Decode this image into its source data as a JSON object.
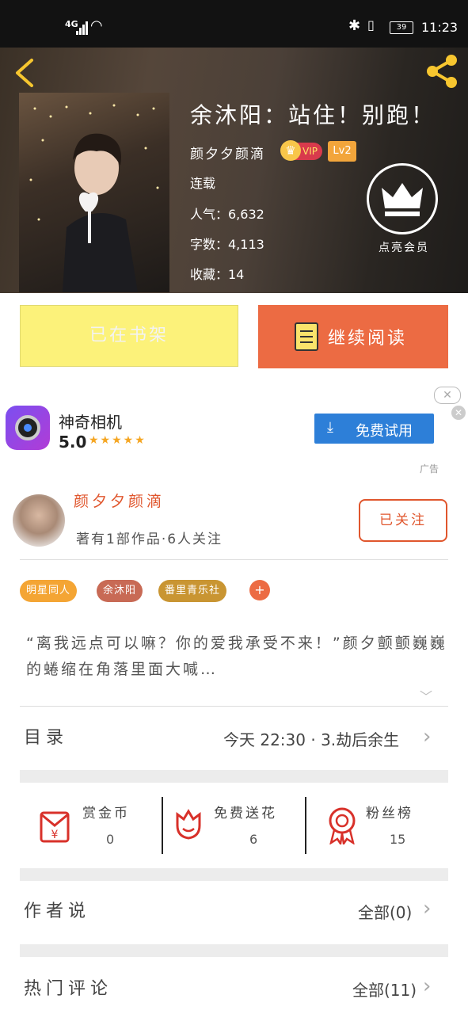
{
  "status_bar": {
    "signal_type": "4G",
    "battery": "39",
    "time": "11:23"
  },
  "book": {
    "title": "余沐阳：站住！别跑！",
    "author": "颜夕夕颜滴",
    "vip_label": "VIP",
    "level": "Lv2",
    "status": "连载",
    "popularity": "人气：6,632",
    "word_count": "字数：4,113",
    "favorites": "收藏：14",
    "recommend_label": "点亮会员"
  },
  "actions": {
    "shelf_label": "已在书架",
    "read_label": "继续阅读"
  },
  "ad": {
    "app_name": "神奇相机",
    "rating": "5.0",
    "stars": "★★★★★",
    "cta": "免费试用",
    "label": "广告"
  },
  "author_section": {
    "name": "颜夕夕颜滴",
    "meta": "著有1部作品·6人关注",
    "follow_label": "已关注"
  },
  "tags": [
    "明星同人",
    "余沐阳",
    "番里青乐社"
  ],
  "tag_add": "+",
  "synopsis": "“离我远点可以嘛？你的爱我承受不来！”颜夕颤颤巍巍的蜷缩在角落里面大喊…",
  "catalog": {
    "title": "目录",
    "latest": "今天 22:30 · 3.劫后余生"
  },
  "stats": [
    {
      "label": "赏金币",
      "value": "0",
      "icon": "red-envelope-icon"
    },
    {
      "label": "免费送花",
      "value": "6",
      "icon": "flower-icon"
    },
    {
      "label": "粉丝榜",
      "value": "15",
      "icon": "medal-icon"
    }
  ],
  "author_notes": {
    "title": "作者说",
    "value": "全部(0)"
  },
  "comments": {
    "title": "热门评论",
    "value": "全部(11)"
  },
  "colors": {
    "accent": "#ec6b43",
    "shelf": "#fcf27a",
    "author": "#e0562d",
    "ad_button": "#2d7fd8"
  }
}
